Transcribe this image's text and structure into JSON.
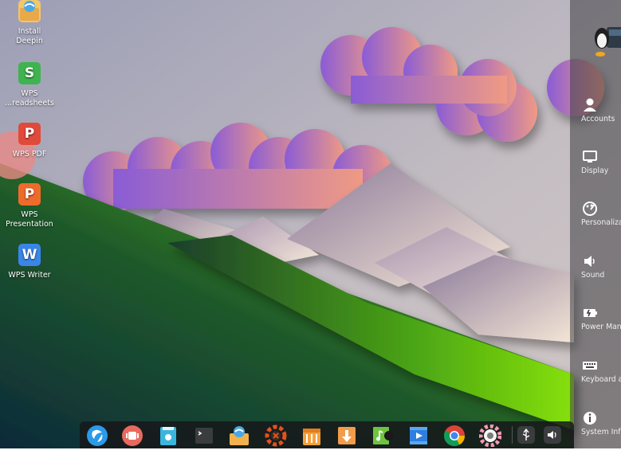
{
  "desktop": {
    "icons": [
      {
        "label": "Install\nDeepin",
        "icon": "install-box-icon"
      },
      {
        "label": "WPS\n...readsheets",
        "icon": "wps-spreadsheets-icon",
        "glyph": "S",
        "color": "#3fb34f"
      },
      {
        "label": "WPS PDF",
        "icon": "wps-pdf-icon",
        "glyph": "P",
        "color": "#e04a3a"
      },
      {
        "label": "WPS\nPresentation",
        "icon": "wps-presentation-icon",
        "glyph": "P",
        "color": "#ee6b2b"
      },
      {
        "label": "WPS Writer",
        "icon": "wps-writer-icon",
        "glyph": "W",
        "color": "#3a86e8"
      }
    ]
  },
  "control_center": {
    "items": [
      {
        "label": "Accounts",
        "icon": "accounts-icon"
      },
      {
        "label": "Display",
        "icon": "display-icon"
      },
      {
        "label": "Personaliza",
        "icon": "personalization-icon"
      },
      {
        "label": "Sound",
        "icon": "sound-icon"
      },
      {
        "label": "Power Mana",
        "icon": "power-management-icon"
      },
      {
        "label": "Keyboard a",
        "icon": "keyboard-icon"
      },
      {
        "label": "System Info",
        "icon": "system-info-icon"
      }
    ]
  },
  "dock": {
    "apps": [
      "launcher-icon",
      "multitasking-icon",
      "file-manager-icon",
      "terminal-icon",
      "install-deepin-icon",
      "system-tool-icon",
      "app-store-icon",
      "download-icon",
      "music-icon",
      "video-icon",
      "chrome-icon",
      "settings-icon"
    ],
    "tray": [
      "usb-icon",
      "volume-icon"
    ]
  }
}
